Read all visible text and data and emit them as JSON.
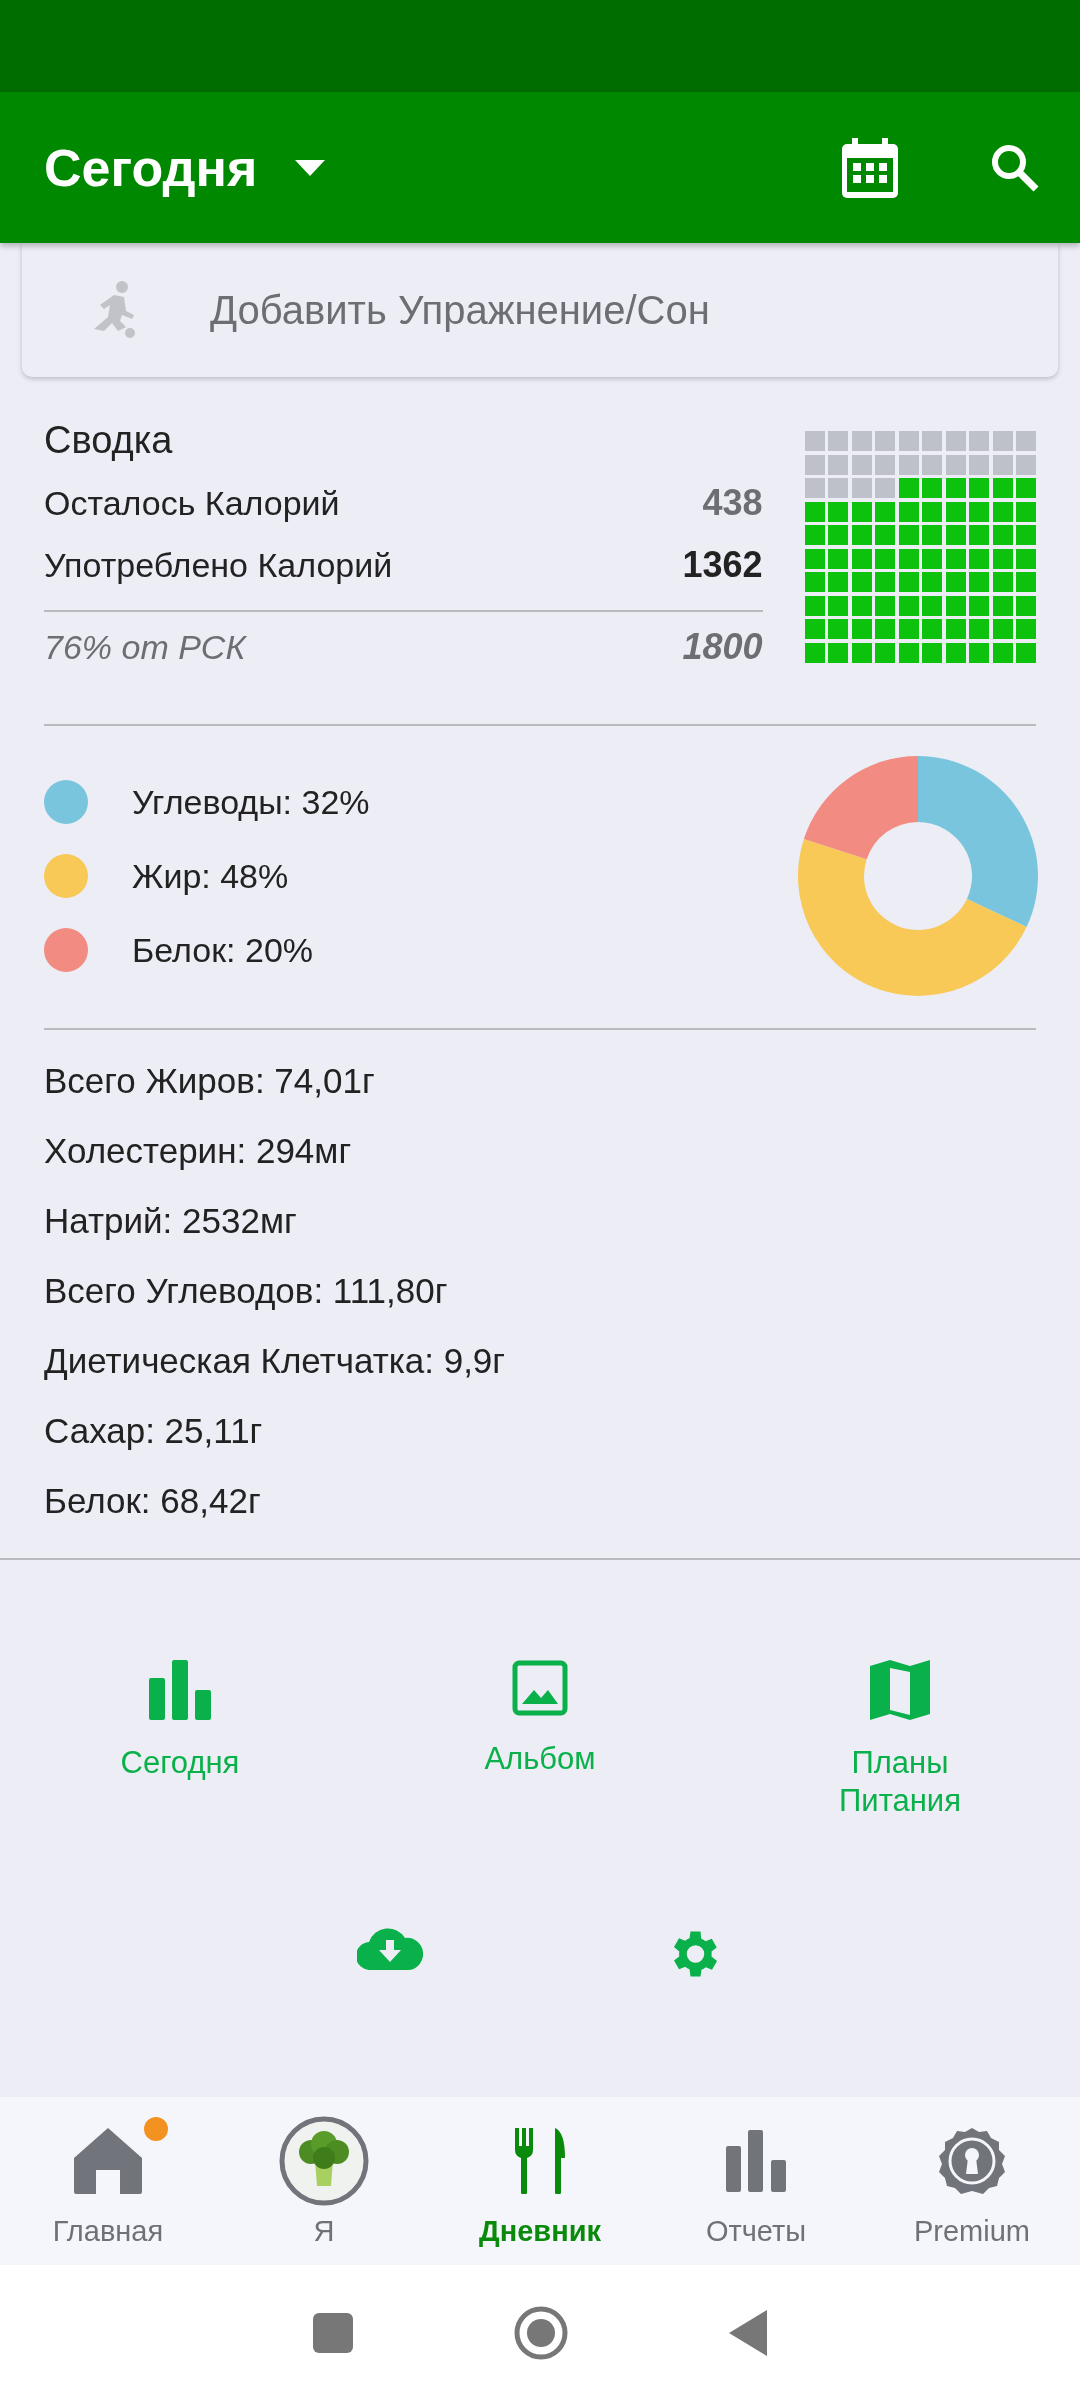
{
  "app_bar": {
    "title": "Сегодня"
  },
  "exercise_card": {
    "label": "Добавить Упражнение/Сон"
  },
  "summary": {
    "title": "Сводка",
    "rows": [
      {
        "label": "Осталось Калорий",
        "value": "438",
        "kind": "remaining"
      },
      {
        "label": "Употреблено Калорий",
        "value": "1362",
        "kind": "consumed"
      }
    ],
    "goal_label": "76% от РСК",
    "goal_value": "1800"
  },
  "macros": {
    "items": [
      {
        "label": "Углеводы: 32%",
        "color": "#7ac5de"
      },
      {
        "label": "Жир: 48%",
        "color": "#f8c957"
      },
      {
        "label": "Белок: 20%",
        "color": "#f28b82"
      }
    ],
    "chart_data": {
      "type": "donut",
      "values": [
        32,
        48,
        20
      ]
    }
  },
  "nutrients": [
    "Всего Жиров: 74,01г",
    "Холестерин: 294мг",
    "Натрий: 2532мг",
    "Всего Углеводов: 111,80г",
    "Диетическая Клетчатка: 9,9г",
    "Сахар: 25,11г",
    "Белок: 68,42г"
  ],
  "shortcuts": [
    {
      "label": "Сегодня",
      "kind": "chart"
    },
    {
      "label": "Альбом",
      "kind": "image"
    },
    {
      "label": "Планы\nПитания",
      "kind": "map"
    }
  ],
  "shortcuts_row_2": [
    {
      "kind": "cloud"
    },
    {
      "kind": "settings"
    }
  ],
  "bottom_nav": [
    {
      "label": "Главная",
      "kind": "home",
      "selected": false,
      "dot": true
    },
    {
      "label": "Я",
      "kind": "avatar",
      "selected": false,
      "dot": false
    },
    {
      "label": "Дневник",
      "kind": "diary",
      "selected": true,
      "dot": false
    },
    {
      "label": "Отчеты",
      "kind": "reports",
      "selected": false,
      "dot": false
    },
    {
      "label": "Premium",
      "kind": "premium",
      "selected": false,
      "dot": false
    }
  ]
}
